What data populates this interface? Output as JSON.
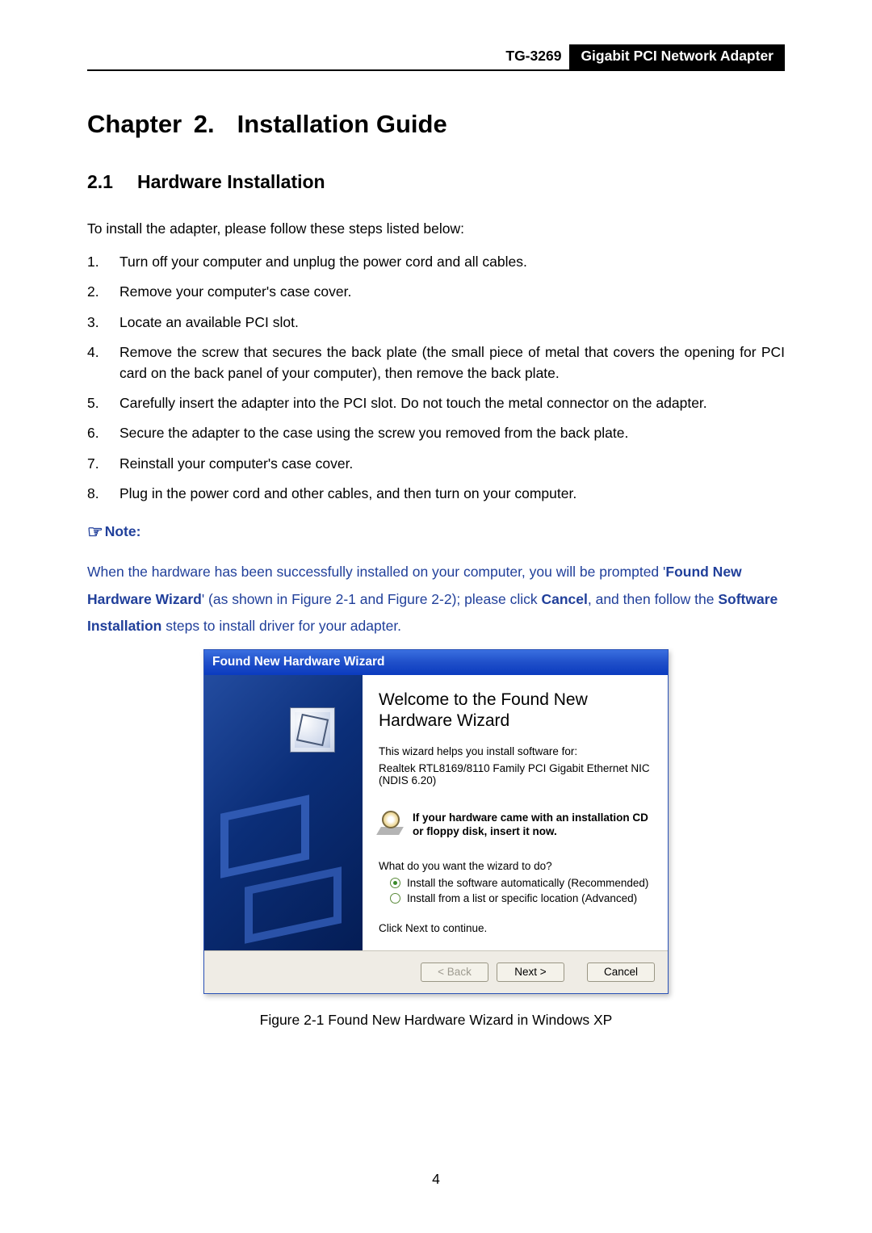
{
  "header": {
    "model": "TG-3269",
    "title": "Gigabit PCI Network Adapter"
  },
  "chapter": {
    "num": "Chapter 2.",
    "title": "Installation Guide"
  },
  "section": {
    "num": "2.1",
    "title": "Hardware Installation"
  },
  "intro": "To install the adapter, please follow these steps listed below:",
  "steps": [
    "Turn off your computer and unplug the power cord and all cables.",
    "Remove your computer's case cover.",
    "Locate an available PCI slot.",
    "Remove the screw that secures the back plate (the small piece of metal that covers the opening for PCI card on the back panel of your computer), then remove the back plate.",
    "Carefully insert the adapter into the PCI slot. Do not touch the metal connector on the adapter.",
    "Secure the adapter to the case using the screw you removed from the back plate.",
    "Reinstall your computer's case cover.",
    "Plug in the power cord and other cables, and then turn on your computer."
  ],
  "note": {
    "label": "Note:",
    "pre": "When the hardware has been successfully installed on your computer, you will be prompted '",
    "bold1": "Found New Hardware Wizard",
    "mid1": "' (as shown in Figure 2-1 and Figure 2-2); please click ",
    "bold2": "Cancel",
    "mid2": ", and then follow the ",
    "bold3": "Software Installation",
    "post": " steps to install driver for your adapter."
  },
  "wizard": {
    "titlebar": "Found New Hardware Wizard",
    "heading": "Welcome to the Found New Hardware Wizard",
    "helps": "This wizard helps you install software for:",
    "device": "Realtek RTL8169/8110 Family PCI Gigabit Ethernet NIC (NDIS 6.20)",
    "cd": "If your hardware came with an installation CD or floppy disk, insert it now.",
    "question": "What do you want the wizard to do?",
    "opt1": "Install the software automatically (Recommended)",
    "opt2": "Install from a list or specific location (Advanced)",
    "cont": "Click Next to continue.",
    "back": "< Back",
    "next": "Next >",
    "cancel": "Cancel"
  },
  "caption": "Figure 2-1 Found New Hardware Wizard in Windows XP",
  "page_number": "4"
}
